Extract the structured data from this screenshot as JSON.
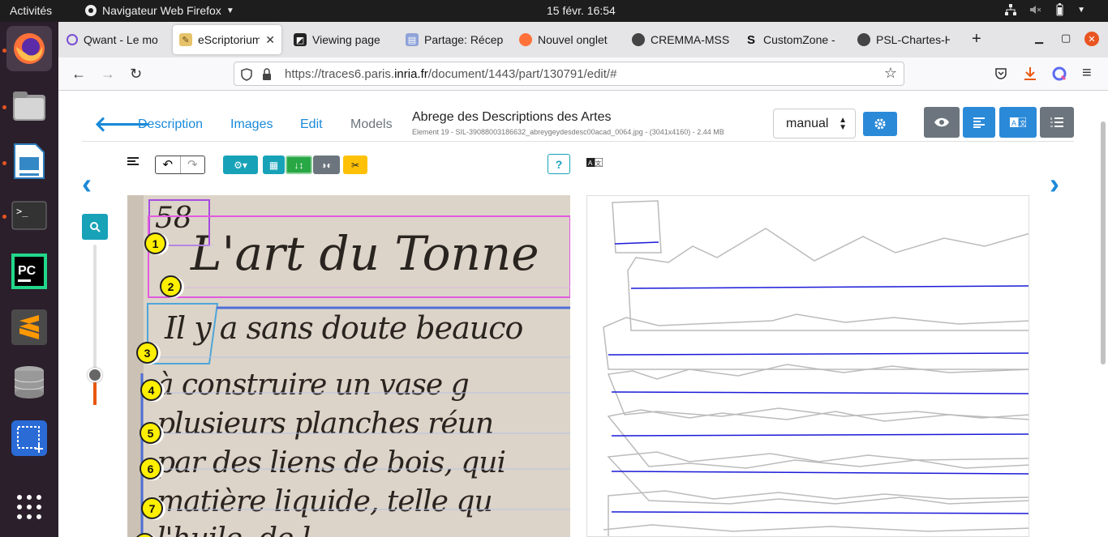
{
  "topbar": {
    "activities": "Activités",
    "app_name": "Navigateur Web Firefox",
    "clock": "15 févr.  16:54"
  },
  "tabs": [
    {
      "title": "Qwant - Le mo",
      "icon": "qwant-icon"
    },
    {
      "title": "eScriptorium",
      "icon": "escriptorium-icon",
      "active": true
    },
    {
      "title": "Viewing page",
      "icon": "viewer-icon"
    },
    {
      "title": "Partage: Récep",
      "icon": "share-icon"
    },
    {
      "title": "Nouvel onglet",
      "icon": "firefox-icon"
    },
    {
      "title": "CREMMA-MSS",
      "icon": "github-icon"
    },
    {
      "title": "CustomZone -",
      "icon": "s-icon"
    },
    {
      "title": "PSL-Chartes-H",
      "icon": "github-icon"
    }
  ],
  "navbar": {
    "url_prefix": "https://traces6.paris.",
    "url_domain": "inria.fr",
    "url_suffix": "/document/1443/part/130791/edit/#"
  },
  "page": {
    "nav_links": [
      "Description",
      "Images",
      "Edit",
      "Models"
    ],
    "doc_title": "Abrege des Descriptions des Artes",
    "doc_meta": "Element 19 - SIL-39088003186632_abreygeydesdesc00acad_0064.jpg - (3041x4160) - 2.44 MB",
    "mode_select": "manual",
    "help_label": "?"
  },
  "manuscript": {
    "page_number": "58",
    "lines": [
      "L'art du Tonne",
      "Il y a sans doute beauco",
      "à construire un vase g",
      "plusieurs planches réun",
      "par des liens de bois, qui",
      "matière liquide, telle qu",
      "l'huile, de l..."
    ]
  },
  "line_numbers": [
    "1",
    "2",
    "3",
    "4",
    "5",
    "6",
    "7"
  ],
  "colors": {
    "accent": "#2b8ad8",
    "teal": "#17a2b8",
    "green": "#28a745",
    "warning": "#ffc107",
    "badge": "#ffef00"
  }
}
